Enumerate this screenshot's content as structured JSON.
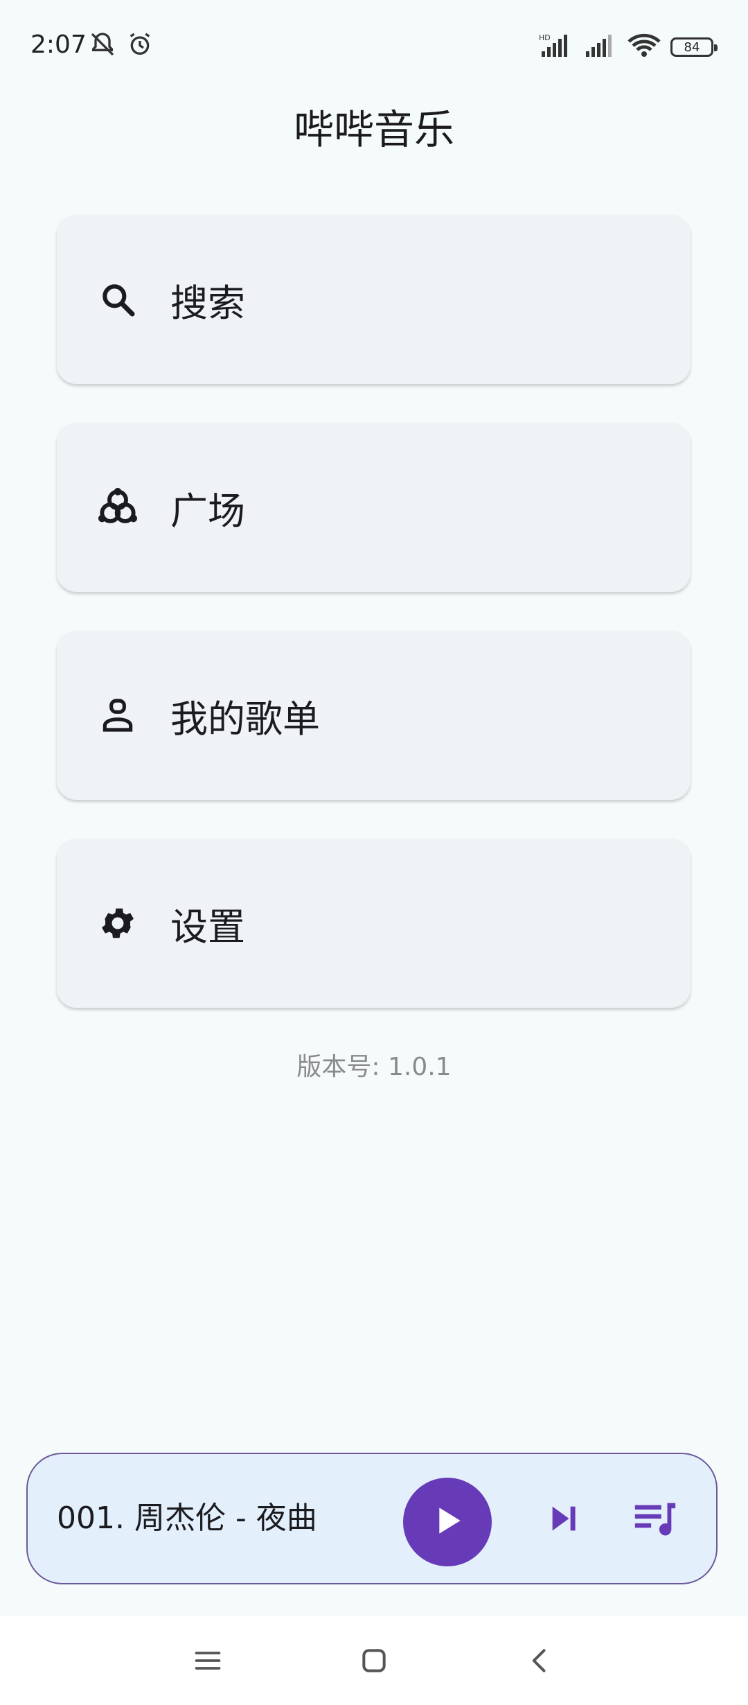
{
  "status_bar": {
    "time": "2:07",
    "battery": "84",
    "network_label": "HD"
  },
  "app": {
    "title": "哔哔音乐"
  },
  "menu": [
    {
      "label": "搜索",
      "icon": "search-icon"
    },
    {
      "label": "广场",
      "icon": "plaza-icon"
    },
    {
      "label": "我的歌单",
      "icon": "user-playlist-icon"
    },
    {
      "label": "设置",
      "icon": "gear-icon"
    }
  ],
  "version": "版本号: 1.0.1",
  "player": {
    "track": "001. 周杰伦 - 夜曲"
  },
  "colors": {
    "accent": "#673ab7",
    "card": "#eff3f6",
    "player_bg": "#e3effb"
  }
}
